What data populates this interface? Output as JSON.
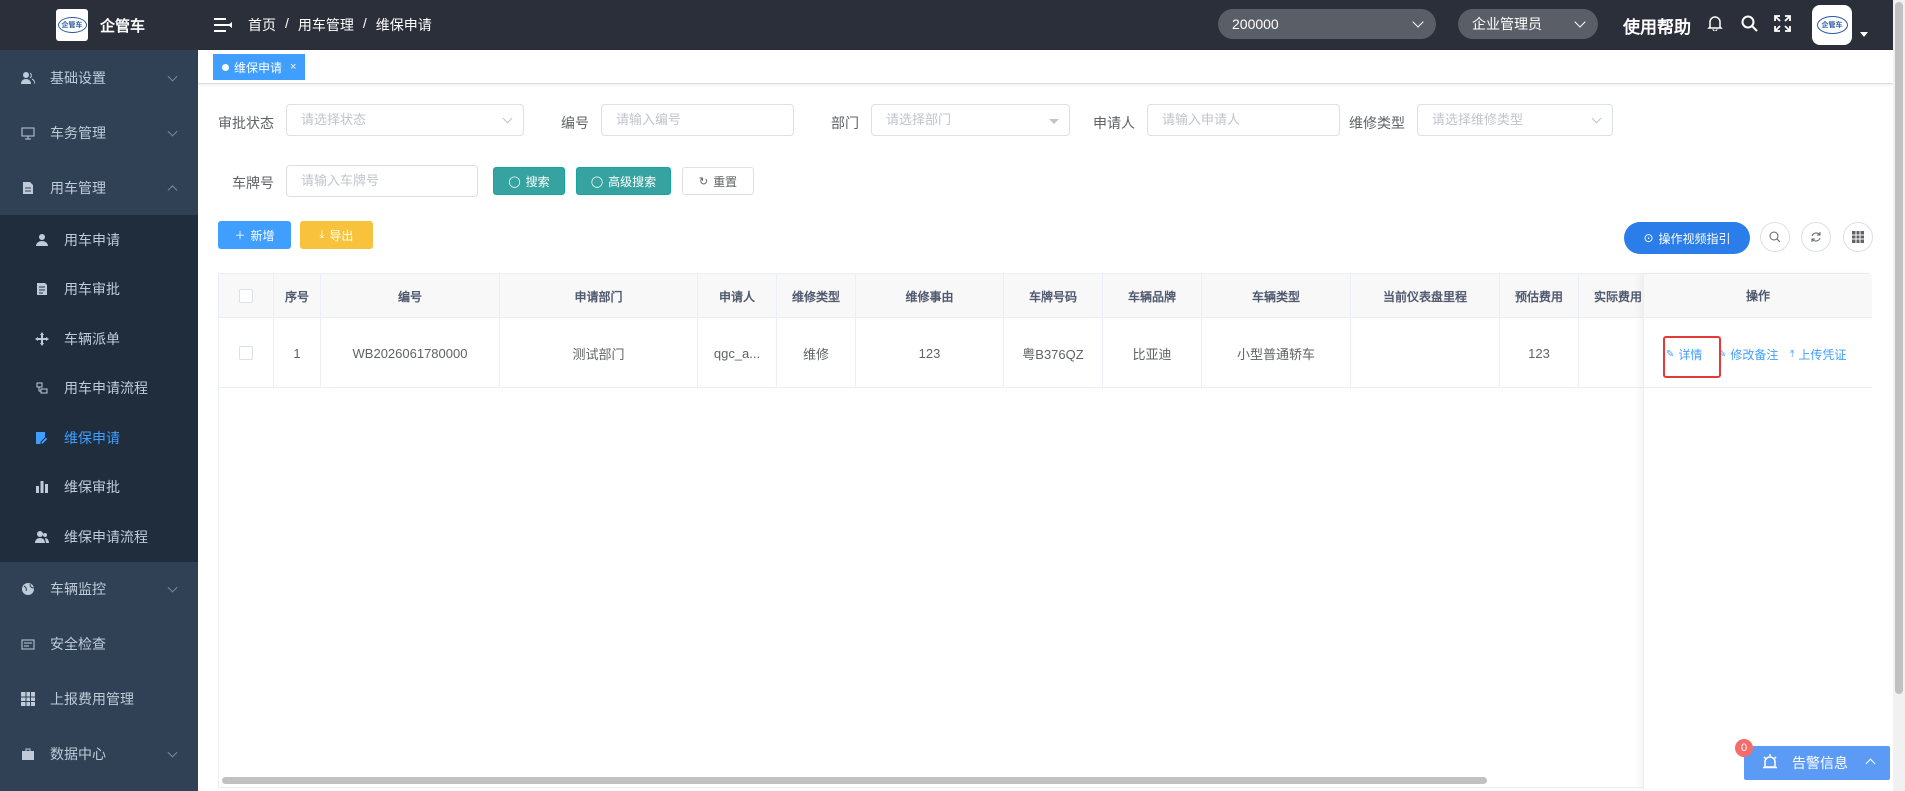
{
  "app": {
    "name": "企管车",
    "logo_text": "企管车"
  },
  "sidebar": {
    "items": [
      {
        "label": "基础设置",
        "icon": "users-icon",
        "expanded": false
      },
      {
        "label": "车务管理",
        "icon": "monitor-icon",
        "expanded": false
      },
      {
        "label": "用车管理",
        "icon": "document-icon",
        "expanded": true
      },
      {
        "label": "车辆监控",
        "icon": "globe-icon",
        "expanded": false
      },
      {
        "label": "安全检查",
        "icon": "card-icon",
        "expanded": false
      },
      {
        "label": "上报费用管理",
        "icon": "grid-icon",
        "expanded": false
      },
      {
        "label": "数据中心",
        "icon": "briefcase-icon",
        "expanded": false
      }
    ],
    "sub_items": [
      {
        "label": "用车申请",
        "icon": "user-icon"
      },
      {
        "label": "用车审批",
        "icon": "form-icon"
      },
      {
        "label": "车辆派单",
        "icon": "move-icon"
      },
      {
        "label": "用车申请流程",
        "icon": "flow-icon"
      },
      {
        "label": "维保申请",
        "icon": "edit-icon",
        "active": true
      },
      {
        "label": "维保审批",
        "icon": "chart-icon"
      },
      {
        "label": "维保申请流程",
        "icon": "peoples-icon"
      }
    ]
  },
  "header": {
    "breadcrumb": [
      "首页",
      "用车管理",
      "维保申请"
    ],
    "company_select": "200000",
    "role_select": "企业管理员",
    "help": "使用帮助",
    "avatar_text": "企管车"
  },
  "tags": [
    {
      "label": "维保申请",
      "close": "×"
    }
  ],
  "filters": {
    "status_label": "审批状态",
    "status_placeholder": "请选择状态",
    "code_label": "编号",
    "code_placeholder": "请输入编号",
    "dept_label": "部门",
    "dept_placeholder": "请选择部门",
    "applicant_label": "申请人",
    "applicant_placeholder": "请输入申请人",
    "type_label": "维修类型",
    "type_placeholder": "请选择维修类型",
    "plate_label": "车牌号",
    "plate_placeholder": "请输入车牌号",
    "search_btn": "搜索",
    "advanced_btn": "高级搜索",
    "reset_btn": "重置"
  },
  "toolbar": {
    "add_btn": "新增",
    "export_btn": "导出",
    "video_btn": "操作视频指引"
  },
  "table": {
    "headers": [
      "序号",
      "编号",
      "申请部门",
      "申请人",
      "维修类型",
      "维修事由",
      "车牌号码",
      "车辆品牌",
      "车辆类型",
      "当前仪表盘里程",
      "预估费用",
      "实际费用",
      "操作"
    ],
    "rows": [
      {
        "index": "1",
        "code": "WB2026061780000",
        "dept": "测试部门",
        "applicant": "qgc_a...",
        "type": "维修",
        "reason": "123",
        "plate": "粤B376QZ",
        "brand": "比亚迪",
        "vehicle_type": "小型普通轿车",
        "mileage": "",
        "est_cost": "123",
        "actual_cost": ""
      }
    ],
    "actions": [
      "详情",
      "修改备注",
      "上传凭证"
    ]
  },
  "alarm": {
    "label": "告警信息",
    "count": "0"
  }
}
